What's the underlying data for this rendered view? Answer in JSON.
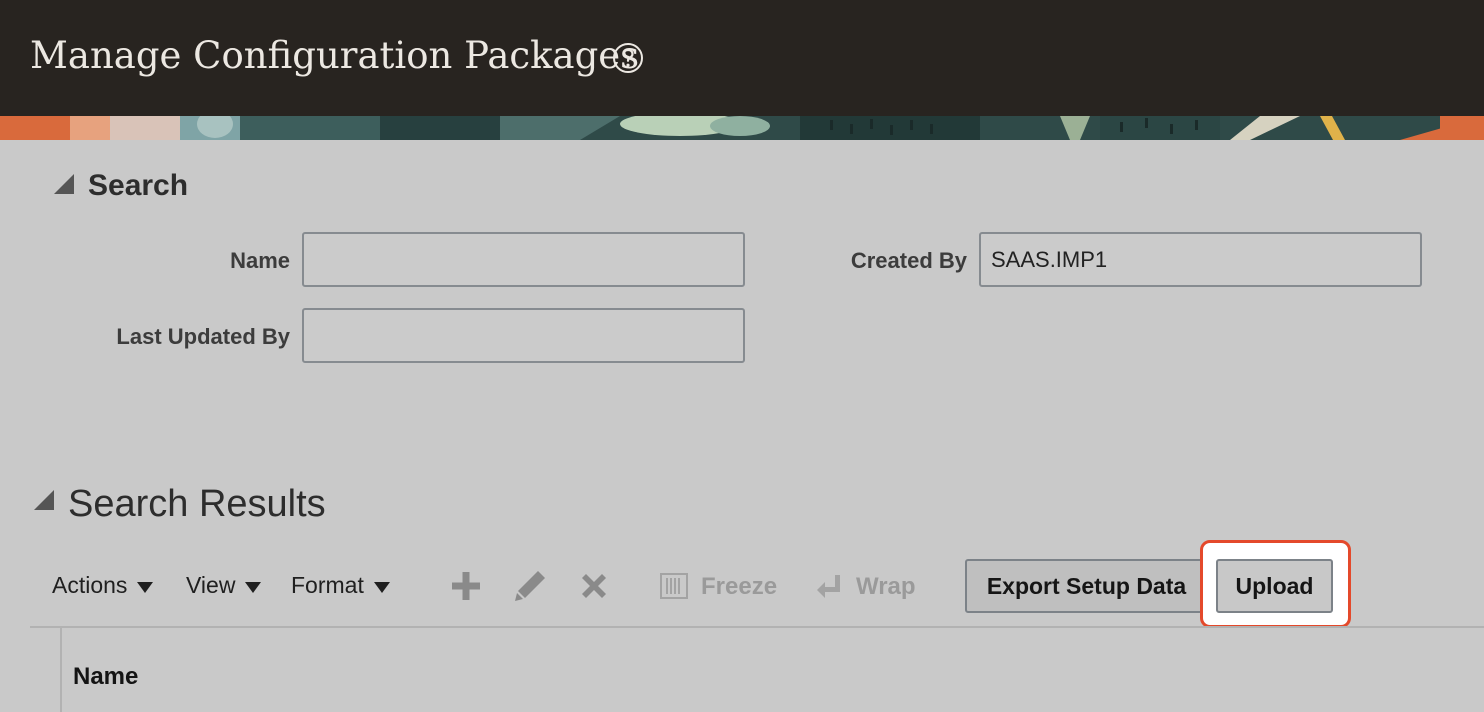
{
  "header": {
    "title": "Manage Configuration Packages",
    "help_icon": "question-circle-icon",
    "background_color": "#282420"
  },
  "search": {
    "heading": "Search",
    "fields": {
      "name": {
        "label": "Name",
        "value": ""
      },
      "created_by": {
        "label": "Created By",
        "value": "SAAS.IMP1"
      },
      "last_updated_by": {
        "label": "Last Updated By",
        "value": ""
      }
    }
  },
  "results": {
    "heading": "Search Results",
    "toolbar": {
      "menus": {
        "actions": "Actions",
        "view": "View",
        "format": "Format"
      },
      "icons": {
        "add": "plus-icon",
        "edit": "pencil-icon",
        "delete": "x-icon",
        "freeze": "freeze-columns-icon",
        "wrap": "wrap-arrow-icon"
      },
      "freeze_label": "Freeze",
      "wrap_label": "Wrap",
      "export_label": "Export Setup Data",
      "upload_label": "Upload"
    },
    "columns": [
      "Name"
    ]
  },
  "colors": {
    "page_background": "#c9c9c9",
    "highlight_outline": "#e4492b",
    "disabled_text": "#9a9a9a"
  }
}
